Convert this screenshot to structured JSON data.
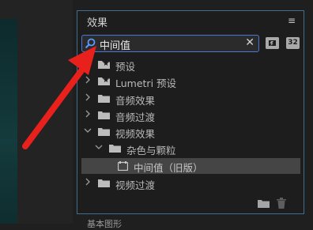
{
  "panel": {
    "title": "效果",
    "menu_icon": "hamburger-menu-icon"
  },
  "search": {
    "value": "中间值",
    "icon": "search-icon",
    "clear_icon": "close-icon"
  },
  "toolbar": {
    "accelerated_label": "",
    "bit32_label": "32"
  },
  "tree": [
    {
      "label": "预设",
      "expanded": false
    },
    {
      "label": "Lumetri 预设",
      "expanded": false
    },
    {
      "label": "音频效果",
      "expanded": false
    },
    {
      "label": "音频过渡",
      "expanded": false
    },
    {
      "label": "视频效果",
      "expanded": true
    },
    {
      "label": "杂色与颗粒",
      "expanded": true
    },
    {
      "label": "中间值（旧版）",
      "selected": true
    },
    {
      "label": "视频过渡",
      "expanded": false
    }
  ],
  "footer": {
    "new_folder_icon": "folder-icon",
    "delete_icon": "trash-icon"
  },
  "bottom_partial_text": "基本图形",
  "annotation": {
    "arrow_color": "#e8211c"
  }
}
